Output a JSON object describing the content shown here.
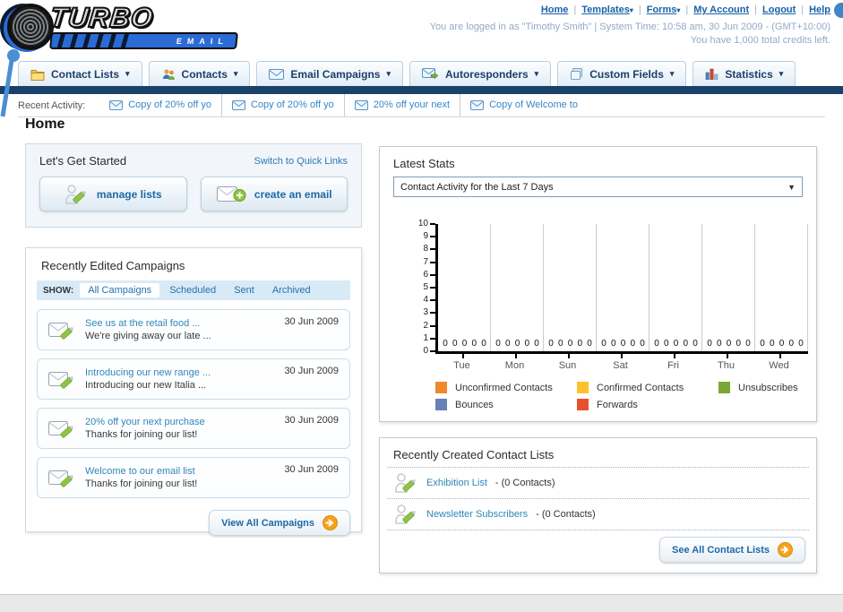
{
  "header": {
    "logo_line1": "TURBO",
    "logo_line2": "EMAIL",
    "nav_links": [
      {
        "label": "Home",
        "arrow": false
      },
      {
        "label": "Templates",
        "arrow": true
      },
      {
        "label": "Forms",
        "arrow": true
      },
      {
        "label": "My Account",
        "arrow": false
      },
      {
        "label": "Logout",
        "arrow": false
      },
      {
        "label": "Help",
        "arrow": false
      }
    ],
    "login_info": "You are logged in as \"Timothy Smith\" | System Time: 10:58 am, 30 Jun 2009 - (GMT+10:00)",
    "credits_info": "You have 1,000 total credits left."
  },
  "nav_tabs": [
    {
      "label": "Contact Lists",
      "icon": "folder-icon"
    },
    {
      "label": "Contacts",
      "icon": "people-icon"
    },
    {
      "label": "Email Campaigns",
      "icon": "envelope-icon"
    },
    {
      "label": "Autoresponders",
      "icon": "envelope-green-arrow-icon"
    },
    {
      "label": "Custom Fields",
      "icon": "pages-icon"
    },
    {
      "label": "Statistics",
      "icon": "bar-chart-icon"
    }
  ],
  "recent_activity": {
    "label": "Recent Activity:",
    "items": [
      "Copy of 20% off yo",
      "Copy of 20% off yo",
      "20% off your next",
      "Copy of Welcome to"
    ]
  },
  "page_title": "Home",
  "get_started": {
    "title": "Let's Get Started",
    "switch_link": "Switch to Quick Links",
    "buttons": [
      {
        "label": "manage lists",
        "icon": "person-pencil-icon"
      },
      {
        "label": "create an email",
        "icon": "envelope-plus-icon"
      }
    ]
  },
  "campaigns": {
    "title": "Recently Edited Campaigns",
    "show_label": "SHOW:",
    "filters": [
      "All Campaigns",
      "Scheduled",
      "Sent",
      "Archived"
    ],
    "active_filter": "All Campaigns",
    "items": [
      {
        "title": "See us at the retail food ...",
        "subtitle": "We're giving away our late ...",
        "date": "30 Jun 2009"
      },
      {
        "title": "Introducing our new range ...",
        "subtitle": "Introducing our new Italia ...",
        "date": "30 Jun 2009"
      },
      {
        "title": "20% off your next purchase",
        "subtitle": "Thanks for joining our list!",
        "date": "30 Jun 2009"
      },
      {
        "title": "Welcome to our email list",
        "subtitle": "Thanks for joining our list!",
        "date": "30 Jun 2009"
      }
    ],
    "view_all_label": "View All Campaigns"
  },
  "stats": {
    "title": "Latest Stats",
    "dropdown_value": "Contact Activity for the Last 7 Days"
  },
  "chart_data": {
    "type": "bar",
    "title": "Contact Activity for the Last 7 Days",
    "categories": [
      "Tue",
      "Mon",
      "Sun",
      "Sat",
      "Fri",
      "Thu",
      "Wed"
    ],
    "series": [
      {
        "name": "Unconfirmed Contacts",
        "color": "#f0892d",
        "values": [
          0,
          0,
          0,
          0,
          0,
          0,
          0
        ]
      },
      {
        "name": "Confirmed Contacts",
        "color": "#fbc32d",
        "values": [
          0,
          0,
          0,
          0,
          0,
          0,
          0
        ]
      },
      {
        "name": "Unsubscribes",
        "color": "#7aa733",
        "values": [
          0,
          0,
          0,
          0,
          0,
          0,
          0
        ]
      },
      {
        "name": "Bounces",
        "color": "#6680b8",
        "values": [
          0,
          0,
          0,
          0,
          0,
          0,
          0
        ]
      },
      {
        "name": "Forwards",
        "color": "#e8502c",
        "values": [
          0,
          0,
          0,
          0,
          0,
          0,
          0
        ]
      }
    ],
    "ylim": [
      0,
      10
    ],
    "yticks": [
      0,
      1,
      2,
      3,
      4,
      5,
      6,
      7,
      8,
      9,
      10
    ],
    "grid": true,
    "legend_position": "bottom"
  },
  "contact_lists": {
    "title": "Recently Created Contact Lists",
    "items": [
      {
        "name": "Exhibition List",
        "suffix": " - (0 Contacts)"
      },
      {
        "name": "Newsletter Subscribers",
        "suffix": " - (0 Contacts)"
      }
    ],
    "see_all_label": "See All Contact Lists"
  }
}
